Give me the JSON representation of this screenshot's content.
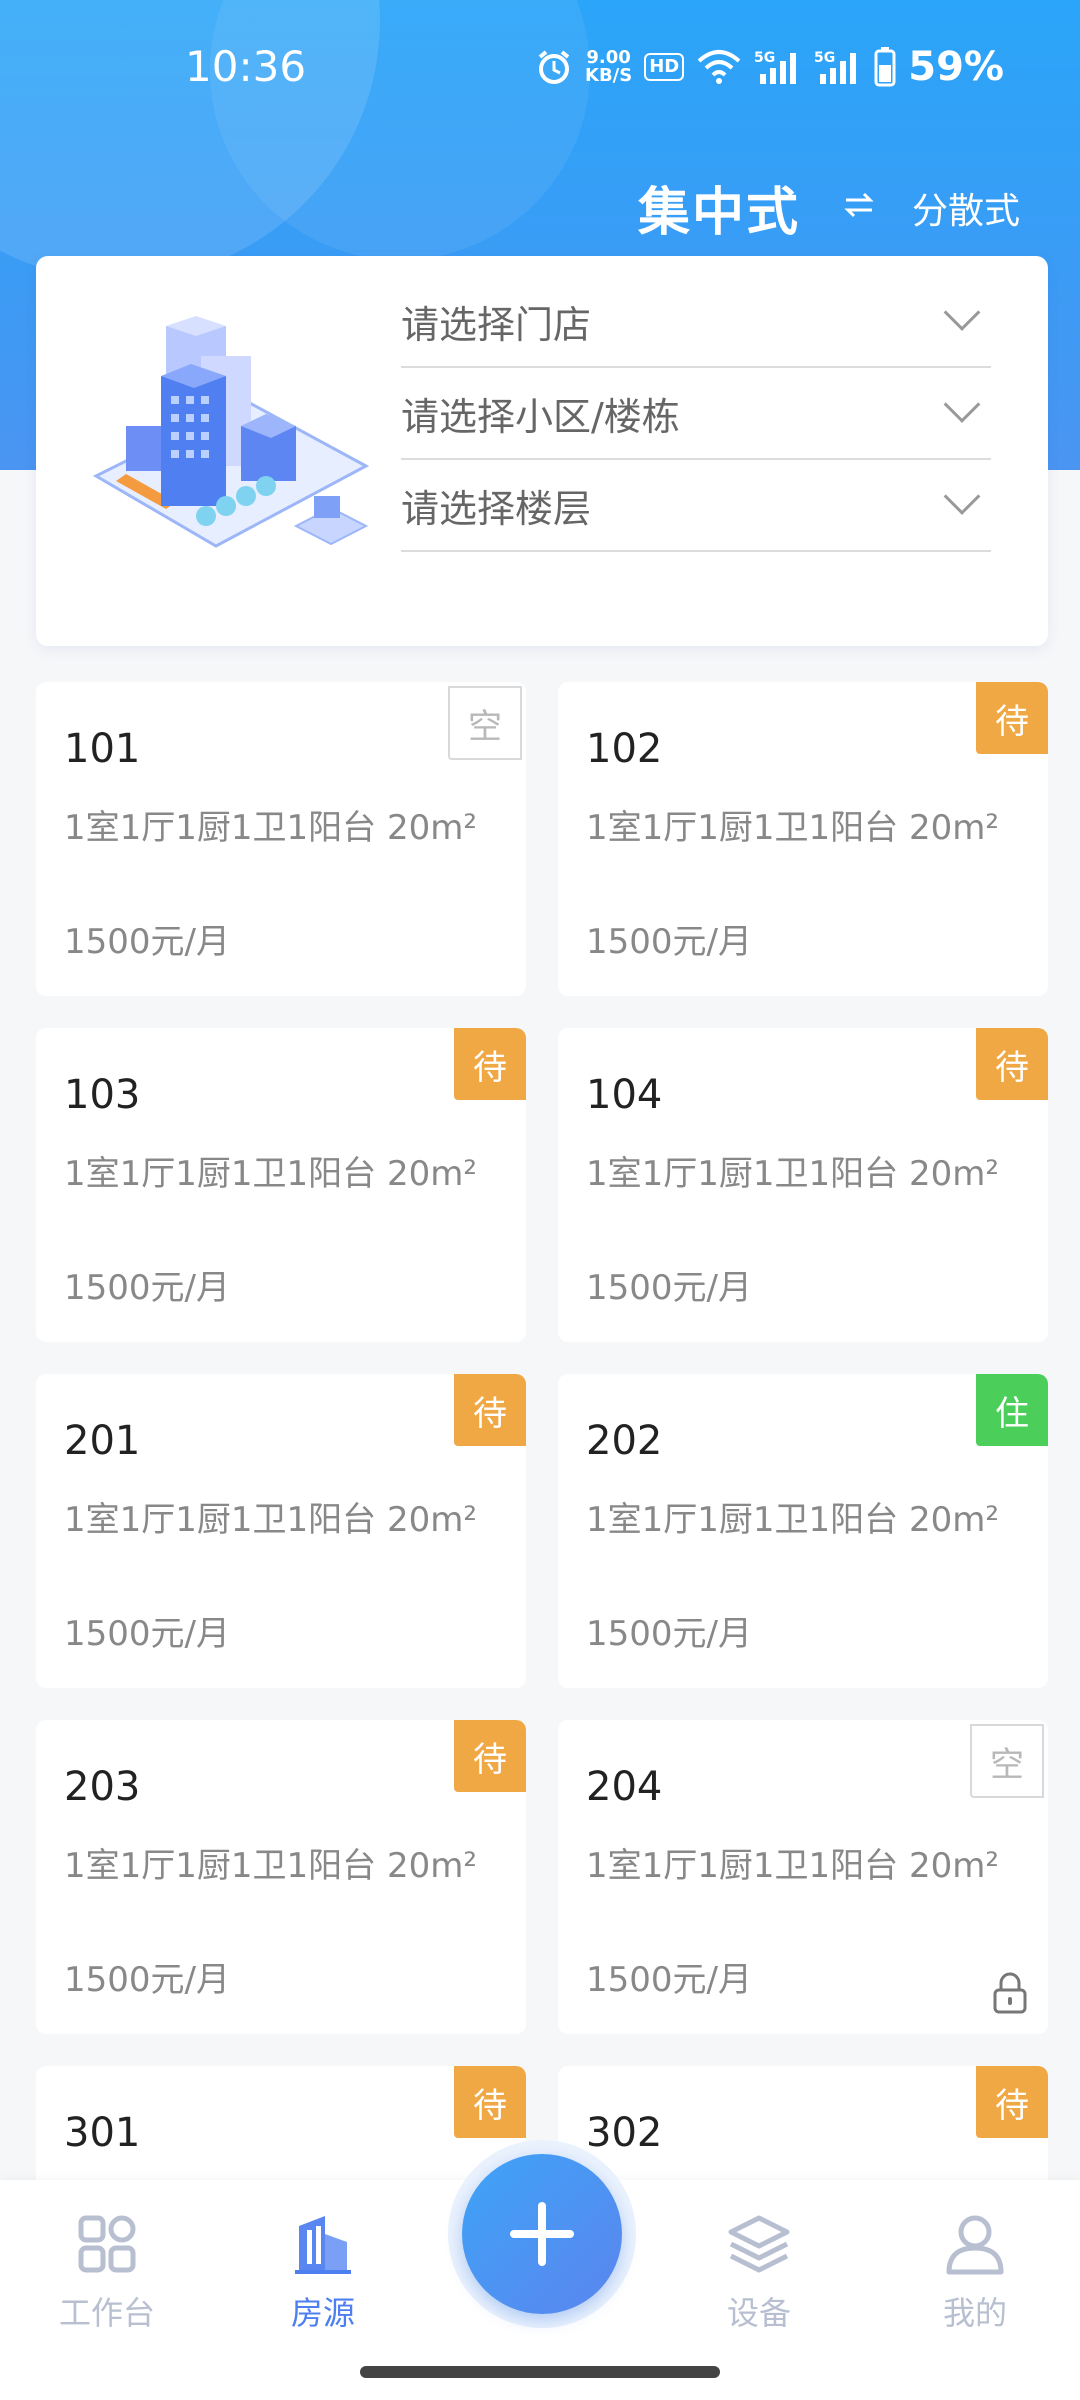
{
  "status_bar": {
    "time": "10:36",
    "speed_value": "9.00",
    "speed_unit": "KB/S",
    "hd": "HD",
    "net1": "5G",
    "net2": "5G",
    "battery": "59%"
  },
  "mode_switch": {
    "active": "集中式",
    "other": "分散式",
    "swap_icon": "swap-arrows-icon"
  },
  "selectors": [
    {
      "label": "请选择门店"
    },
    {
      "label": "请选择小区/楼栋"
    },
    {
      "label": "请选择楼层"
    }
  ],
  "rooms": [
    {
      "number": "101",
      "desc": "1室1厅1厨1卫1阳台 20m²",
      "price": "1500元/月",
      "status": "空",
      "status_type": "empty",
      "locked": false
    },
    {
      "number": "102",
      "desc": "1室1厅1厨1卫1阳台 20m²",
      "price": "1500元/月",
      "status": "待",
      "status_type": "wait",
      "locked": false
    },
    {
      "number": "103",
      "desc": "1室1厅1厨1卫1阳台 20m²",
      "price": "1500元/月",
      "status": "待",
      "status_type": "wait",
      "locked": false
    },
    {
      "number": "104",
      "desc": "1室1厅1厨1卫1阳台 20m²",
      "price": "1500元/月",
      "status": "待",
      "status_type": "wait",
      "locked": false
    },
    {
      "number": "201",
      "desc": "1室1厅1厨1卫1阳台 20m²",
      "price": "1500元/月",
      "status": "待",
      "status_type": "wait",
      "locked": false
    },
    {
      "number": "202",
      "desc": "1室1厅1厨1卫1阳台 20m²",
      "price": "1500元/月",
      "status": "住",
      "status_type": "live",
      "locked": false
    },
    {
      "number": "203",
      "desc": "1室1厅1厨1卫1阳台 20m²",
      "price": "1500元/月",
      "status": "待",
      "status_type": "wait",
      "locked": false
    },
    {
      "number": "204",
      "desc": "1室1厅1厨1卫1阳台 20m²",
      "price": "1500元/月",
      "status": "空",
      "status_type": "empty",
      "locked": true
    },
    {
      "number": "301",
      "desc": "",
      "price": "",
      "status": "待",
      "status_type": "wait",
      "locked": false
    },
    {
      "number": "302",
      "desc": "",
      "price": "",
      "status": "待",
      "status_type": "wait",
      "locked": false
    }
  ],
  "bottom_nav": {
    "items": [
      {
        "label": "工作台",
        "icon": "grid-icon"
      },
      {
        "label": "房源",
        "icon": "building-icon"
      },
      {
        "label": "设备",
        "icon": "layers-icon"
      },
      {
        "label": "我的",
        "icon": "user-icon"
      }
    ],
    "fab_icon": "plus-icon"
  },
  "colors": {
    "primary": "#3a9cf5",
    "wait": "#f0a844",
    "live": "#4ccf5a",
    "nav_active": "#4e7ff0",
    "nav_inactive": "#b7bfd0"
  }
}
